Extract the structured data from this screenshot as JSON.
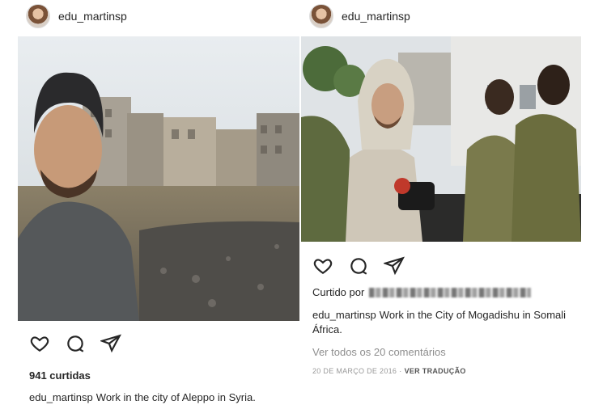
{
  "left_post": {
    "username": "edu_martinsp",
    "likes": "941 curtidas",
    "caption_user": "edu_martinsp",
    "caption_text": "Work in the city of Aleppo in Syria."
  },
  "right_post": {
    "username": "edu_martinsp",
    "liked_by_label": "Curtido por",
    "caption_user": "edu_martinsp",
    "caption_text": "Work in the City of Mogadishu in Somali África.",
    "view_comments": "Ver todos os 20 comentários",
    "date": "20 DE MARÇO DE 2016",
    "separator": "·",
    "translate": "VER TRADUÇÃO"
  },
  "icons": {
    "like": "heart-icon",
    "comment": "comment-icon",
    "share": "share-icon"
  },
  "colors": {
    "text": "#262626",
    "muted": "#8e8e8e"
  }
}
